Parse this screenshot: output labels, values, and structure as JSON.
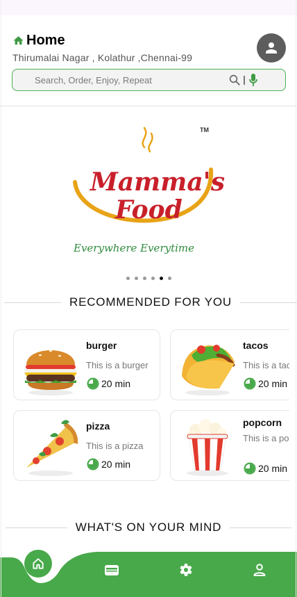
{
  "header": {
    "title": "Home",
    "address": "Thirumalai Nagar , Kolathur ,Chennai-99"
  },
  "search": {
    "placeholder": "Search, Order, Enjoy, Repeat"
  },
  "banner": {
    "brand_line1": "Mamma's",
    "brand_line2": "Food",
    "tagline": "Everywhere  Everytime",
    "tm": "TM",
    "carousel_dots": 6,
    "active_dot": 5
  },
  "sections": {
    "recommended": "RECOMMENDED FOR YOU",
    "mind": "WHAT'S ON YOUR MIND"
  },
  "recommended": [
    {
      "name": "burger",
      "desc": "This is a burger",
      "time": "20 min",
      "icon": "burger-image"
    },
    {
      "name": "tacos",
      "desc": "This is a tacos",
      "time": "20 min",
      "icon": "tacos-image"
    },
    {
      "name": "pizza",
      "desc": "This is a pizza",
      "time": "20 min",
      "icon": "pizza-image"
    },
    {
      "name": "popcorn",
      "desc": "This is a popcorn",
      "time": "20 min",
      "icon": "popcorn-image"
    }
  ],
  "nav": {
    "items": [
      "home-icon",
      "wallet-icon",
      "settings-icon",
      "profile-icon"
    ],
    "active": "home-icon"
  },
  "colors": {
    "accent": "#48a94a",
    "brand_red": "#c8202a",
    "brand_gold": "#e8a317",
    "tagline_green": "#2e8b3d"
  }
}
